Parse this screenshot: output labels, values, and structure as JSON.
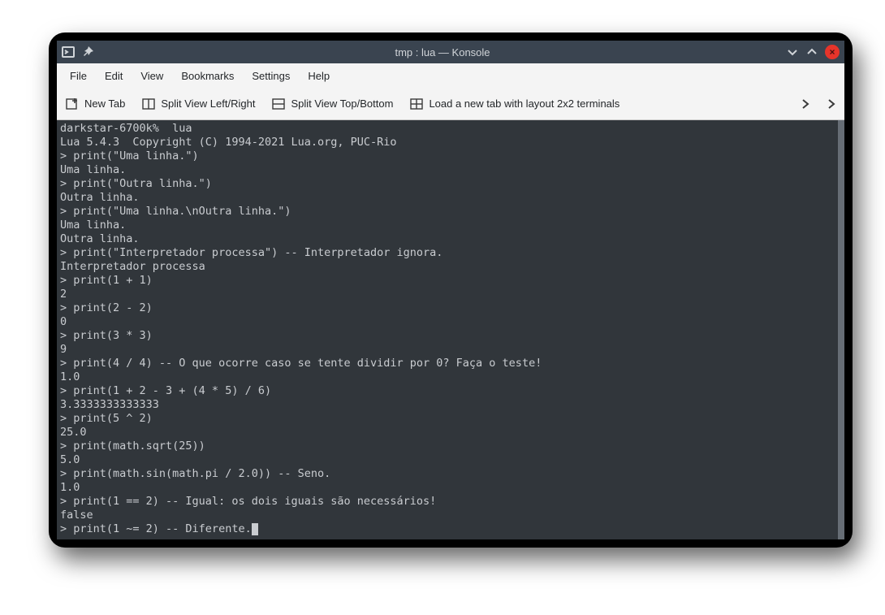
{
  "window": {
    "title": "tmp : lua — Konsole"
  },
  "menubar": [
    "File",
    "Edit",
    "View",
    "Bookmarks",
    "Settings",
    "Help"
  ],
  "toolbar": {
    "new_tab": "New Tab",
    "split_lr": "Split View Left/Right",
    "split_tb": "Split View Top/Bottom",
    "layout_2x2": "Load a new tab with layout 2x2 terminals"
  },
  "terminal": {
    "lines": [
      "darkstar-6700k%  lua",
      "Lua 5.4.3  Copyright (C) 1994-2021 Lua.org, PUC-Rio",
      "> print(\"Uma linha.\")",
      "Uma linha.",
      "> print(\"Outra linha.\")",
      "Outra linha.",
      "> print(\"Uma linha.\\nOutra linha.\")",
      "Uma linha.",
      "Outra linha.",
      "> print(\"Interpretador processa\") -- Interpretador ignora.",
      "Interpretador processa",
      "> print(1 + 1)",
      "2",
      "> print(2 - 2)",
      "0",
      "> print(3 * 3)",
      "9",
      "> print(4 / 4) -- O que ocorre caso se tente dividir por 0? Faça o teste!",
      "1.0",
      "> print(1 + 2 - 3 + (4 * 5) / 6)",
      "3.3333333333333",
      "> print(5 ^ 2)",
      "25.0",
      "> print(math.sqrt(25))",
      "5.0",
      "> print(math.sin(math.pi / 2.0)) -- Seno.",
      "1.0",
      "> print(1 == 2) -- Igual: os dois iguais são necessários!",
      "false",
      "> print(1 ~= 2) -- Diferente."
    ]
  }
}
